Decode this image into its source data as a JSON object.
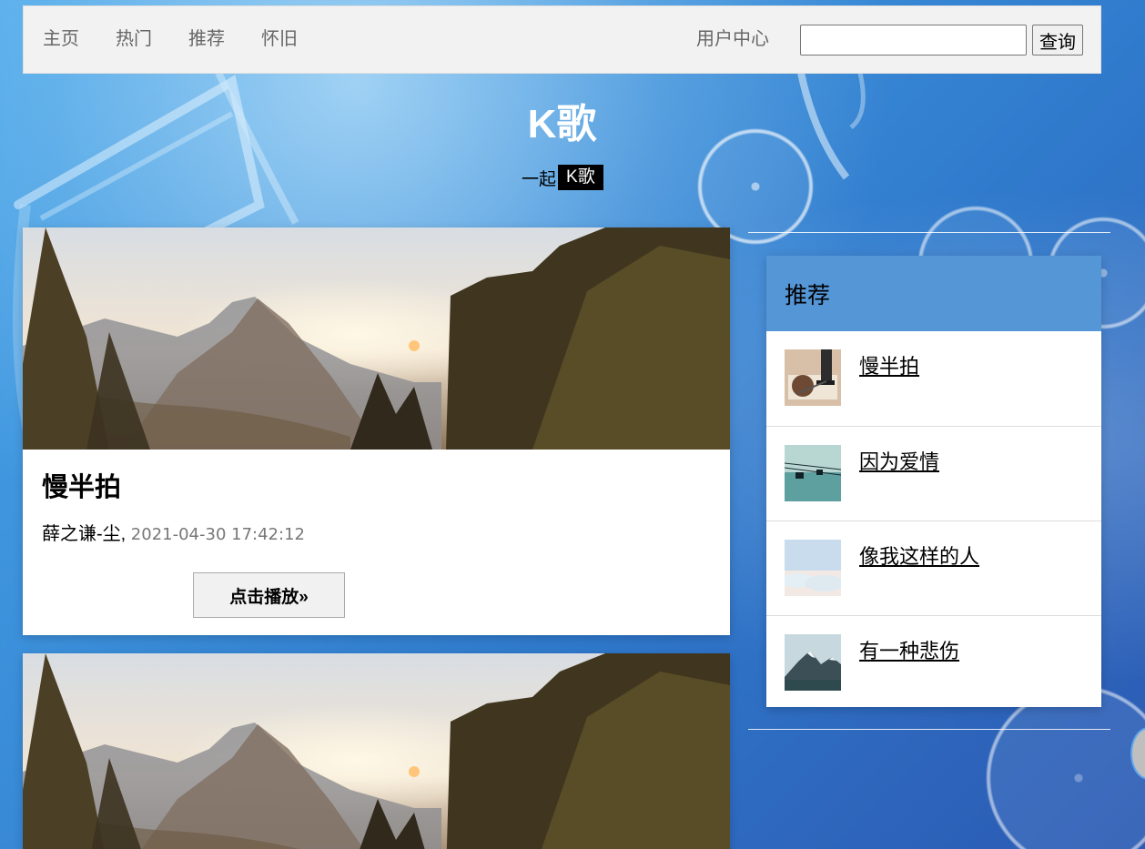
{
  "header": {
    "nav": {
      "home": "主页",
      "hot": "热门",
      "recommend": "推荐",
      "nostalgia": "怀旧"
    },
    "user_center": "用户中心",
    "search": {
      "value": "",
      "placeholder": "",
      "button": "查询"
    }
  },
  "hero": {
    "title": "K歌",
    "subtitle_prefix": "一起",
    "subtitle_tag": "K歌"
  },
  "songs": [
    {
      "title": "慢半拍",
      "artist": "薛之谦-尘",
      "separator": ",",
      "time": "2021-04-30 17:42:12",
      "button": "点击播放»",
      "image_icon": "mountain-landscape-icon"
    },
    {
      "image_icon": "mountain-landscape-icon"
    }
  ],
  "sidebar": {
    "title": "推荐",
    "items": [
      {
        "label": "慢半拍",
        "thumb_icon": "record-player-thumbnail"
      },
      {
        "label": "因为爱情",
        "thumb_icon": "cable-car-thumbnail"
      },
      {
        "label": "像我这样的人",
        "thumb_icon": "cloud-sea-thumbnail"
      },
      {
        "label": "有一种悲伤",
        "thumb_icon": "snow-mountain-thumbnail"
      }
    ]
  },
  "colors": {
    "page_blue": "#3b8fda",
    "nav_background": "#f2f2f2",
    "tag_background": "#000000",
    "panel_header": "#3e88d2"
  }
}
